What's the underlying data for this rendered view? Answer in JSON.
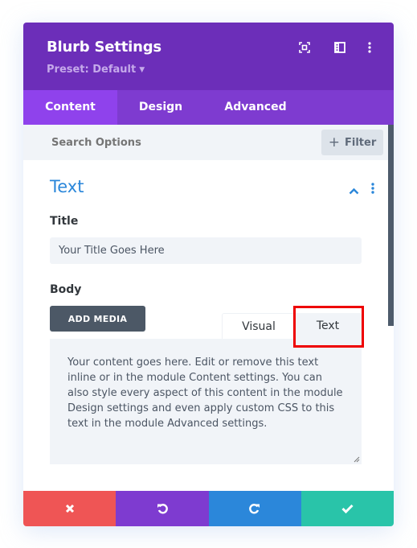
{
  "header": {
    "title": "Blurb Settings",
    "preset_label": "Preset: Default",
    "icons": [
      "focus-icon",
      "sidebar-layout-icon",
      "more-vertical-icon"
    ]
  },
  "tabs": [
    {
      "label": "Content",
      "active": true
    },
    {
      "label": "Design",
      "active": false
    },
    {
      "label": "Advanced",
      "active": false
    }
  ],
  "search": {
    "placeholder": "Search Options",
    "filter_label": "Filter"
  },
  "section": {
    "title": "Text",
    "expanded": true
  },
  "fields": {
    "title_label": "Title",
    "title_value": "Your Title Goes Here",
    "body_label": "Body",
    "add_media_label": "ADD MEDIA",
    "editor_tabs": [
      {
        "label": "Visual",
        "active": false
      },
      {
        "label": "Text",
        "active": true
      }
    ],
    "body_value": "Your content goes here. Edit or remove this text inline or in the module Content settings. You can also style every aspect of this content in the module Design settings and even apply custom CSS to this text in the module Advanced settings."
  },
  "footer": {
    "buttons": [
      {
        "name": "discard",
        "icon": "close-icon",
        "color": "#ef5555"
      },
      {
        "name": "undo",
        "icon": "undo-icon",
        "color": "#7e3bd0"
      },
      {
        "name": "redo",
        "icon": "redo-icon",
        "color": "#2b87da"
      },
      {
        "name": "save",
        "icon": "check-icon",
        "color": "#29c4a9"
      }
    ]
  },
  "colors": {
    "header_bg": "#6c2eb9",
    "tabs_bg": "#7e3bd0",
    "active_tab_bg": "#8f42ec",
    "accent_blue": "#2b87da",
    "highlight_red": "#ee0000"
  }
}
